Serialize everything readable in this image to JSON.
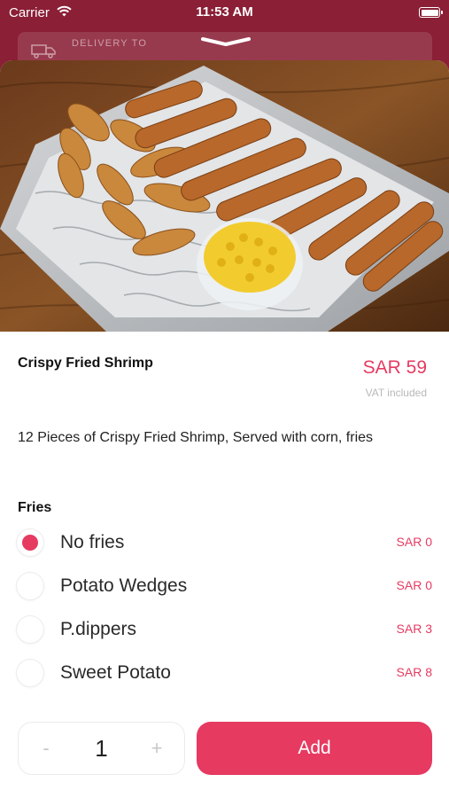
{
  "status_bar": {
    "carrier": "Carrier",
    "time": "11:53 AM"
  },
  "delivery": {
    "label": "DELIVERY TO"
  },
  "product": {
    "name": "Crispy Fried Shrimp",
    "price": "SAR 59",
    "vat_note": "VAT included",
    "description": "12 Pieces of Crispy Fried Shrimp, Served with corn, fries"
  },
  "options_group": {
    "title": "Fries",
    "selected_index": 0,
    "items": [
      {
        "label": "No fries",
        "price": "SAR 0"
      },
      {
        "label": "Potato Wedges",
        "price": "SAR 0"
      },
      {
        "label": "P.dippers",
        "price": "SAR 3"
      },
      {
        "label": "Sweet Potato",
        "price": "SAR 8"
      }
    ]
  },
  "cart": {
    "minus": "-",
    "quantity": "1",
    "plus": "+",
    "add_label": "Add"
  },
  "colors": {
    "accent": "#e63a61",
    "header_bg": "#8a1f36"
  }
}
